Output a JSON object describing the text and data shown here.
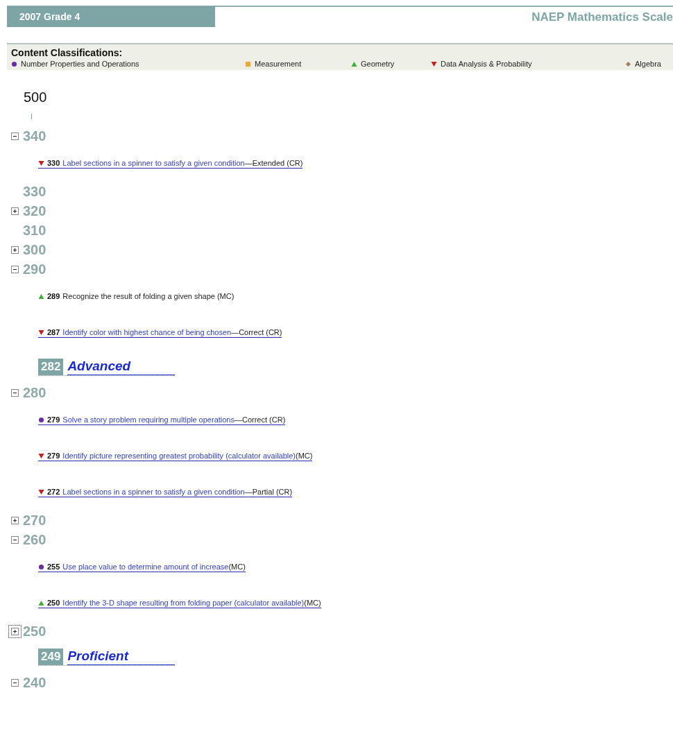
{
  "header": {
    "title": "2007 Grade 4",
    "scale_title": "NAEP Mathematics Scale"
  },
  "legend": {
    "title": "Content Classifications:",
    "items": [
      {
        "label": "Number Properties and Operations",
        "kind": "circle",
        "color": "#6b2c9e"
      },
      {
        "label": "Measurement",
        "kind": "square",
        "color": "#eea83a"
      },
      {
        "label": "Geometry",
        "kind": "triangle",
        "color": "#3fae3a"
      },
      {
        "label": "Data Analysis & Probability",
        "kind": "down",
        "color": "#c41f1f"
      },
      {
        "label": "Algebra",
        "kind": "diamond",
        "color": "#a3805a"
      }
    ]
  },
  "rows": [
    {
      "kind": "top",
      "value": "500"
    },
    {
      "kind": "scale",
      "value": "340",
      "expanded": true
    },
    {
      "kind": "item",
      "color": "#c41f1f",
      "score": "330",
      "link": "Label sections in a spinner to satisfy a given condition",
      "tail": "—Extended (CR)"
    },
    {
      "kind": "scale",
      "value": "330"
    },
    {
      "kind": "scale",
      "value": "320",
      "expanded": false
    },
    {
      "kind": "scale",
      "value": "310"
    },
    {
      "kind": "scale",
      "value": "300",
      "expanded": false
    },
    {
      "kind": "scale",
      "value": "290",
      "expanded": true
    },
    {
      "kind": "item",
      "color": "#3fae3a",
      "score": "289",
      "text": "Recognize the result of folding a given shape (MC)"
    },
    {
      "kind": "item",
      "color": "#c41f1f",
      "score": "287",
      "link": "Identify color with highest chance of being chosen",
      "tail": "—Correct (CR)"
    },
    {
      "kind": "level",
      "score": "282",
      "label": "Advanced"
    },
    {
      "kind": "scale",
      "value": "280",
      "expanded": true
    },
    {
      "kind": "item",
      "color": "#6b2c9e",
      "score": "279",
      "link": "Solve a story problem requiring multiple operations",
      "tail": "—Correct (CR)"
    },
    {
      "kind": "item",
      "color": "#c41f1f",
      "score": "279",
      "link": "Identify picture representing greatest probability (calculator available)",
      "tail": " (MC)"
    },
    {
      "kind": "item",
      "color": "#c41f1f",
      "score": "272",
      "link": "Label sections in a spinner to satisfy a given condition",
      "tail": "—Partial (CR)"
    },
    {
      "kind": "scale",
      "value": "270",
      "expanded": false
    },
    {
      "kind": "scale",
      "value": "260",
      "expanded": true
    },
    {
      "kind": "item",
      "color": "#6b2c9e",
      "score": "255",
      "link": "Use place value to determine amount of increase",
      "tail": " (MC)"
    },
    {
      "kind": "item",
      "color": "#3fae3a",
      "score": "250",
      "link": "Identify the 3-D shape resulting from folding paper (calculator available)",
      "tail": " (MC)"
    },
    {
      "kind": "scale",
      "value": "250",
      "expanded": false,
      "focused": true
    },
    {
      "kind": "level",
      "score": "249",
      "label": "Proficient"
    },
    {
      "kind": "scale",
      "value": "240",
      "expanded": true
    }
  ]
}
